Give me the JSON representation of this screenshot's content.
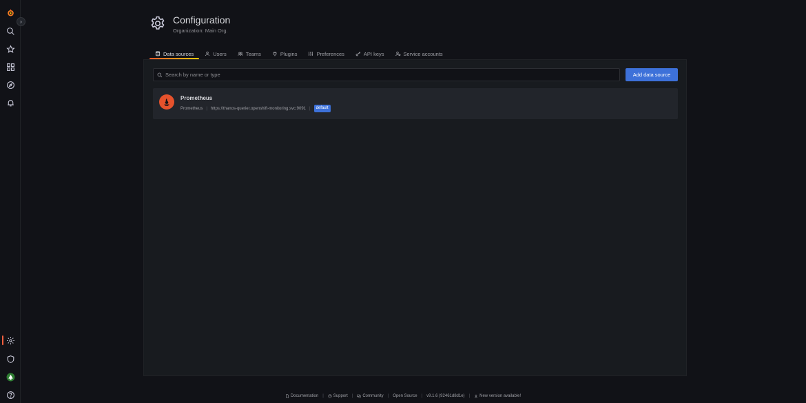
{
  "header": {
    "title": "Configuration",
    "subtitle": "Organization: Main Org."
  },
  "tabs": [
    {
      "label": "Data sources",
      "icon": "database-icon",
      "active": true
    },
    {
      "label": "Users",
      "icon": "user-icon",
      "active": false
    },
    {
      "label": "Teams",
      "icon": "users-icon",
      "active": false
    },
    {
      "label": "Plugins",
      "icon": "plug-icon",
      "active": false
    },
    {
      "label": "Preferences",
      "icon": "sliders-icon",
      "active": false
    },
    {
      "label": "API keys",
      "icon": "key-icon",
      "active": false
    },
    {
      "label": "Service accounts",
      "icon": "service-account-icon",
      "active": false
    }
  ],
  "search": {
    "placeholder": "Search by name or type",
    "value": ""
  },
  "add_button": "Add data source",
  "datasources": [
    {
      "name": "Prometheus",
      "type": "Prometheus",
      "url": "https://thanos-querier.openshift-monitoring.svc:9091",
      "badge": "default"
    }
  ],
  "footer": {
    "documentation": "Documentation",
    "support": "Support",
    "community": "Community",
    "open_source": "Open Source",
    "version": "v9.1.6 (92461d8d1e)",
    "new_version": "New version available!"
  },
  "colors": {
    "accent": "#3d71d9",
    "active_tab_gradient_start": "#f05a28",
    "active_tab_gradient_end": "#fbca0a",
    "prometheus": "#e6522c",
    "background": "#111217",
    "panel": "#181b1f"
  }
}
